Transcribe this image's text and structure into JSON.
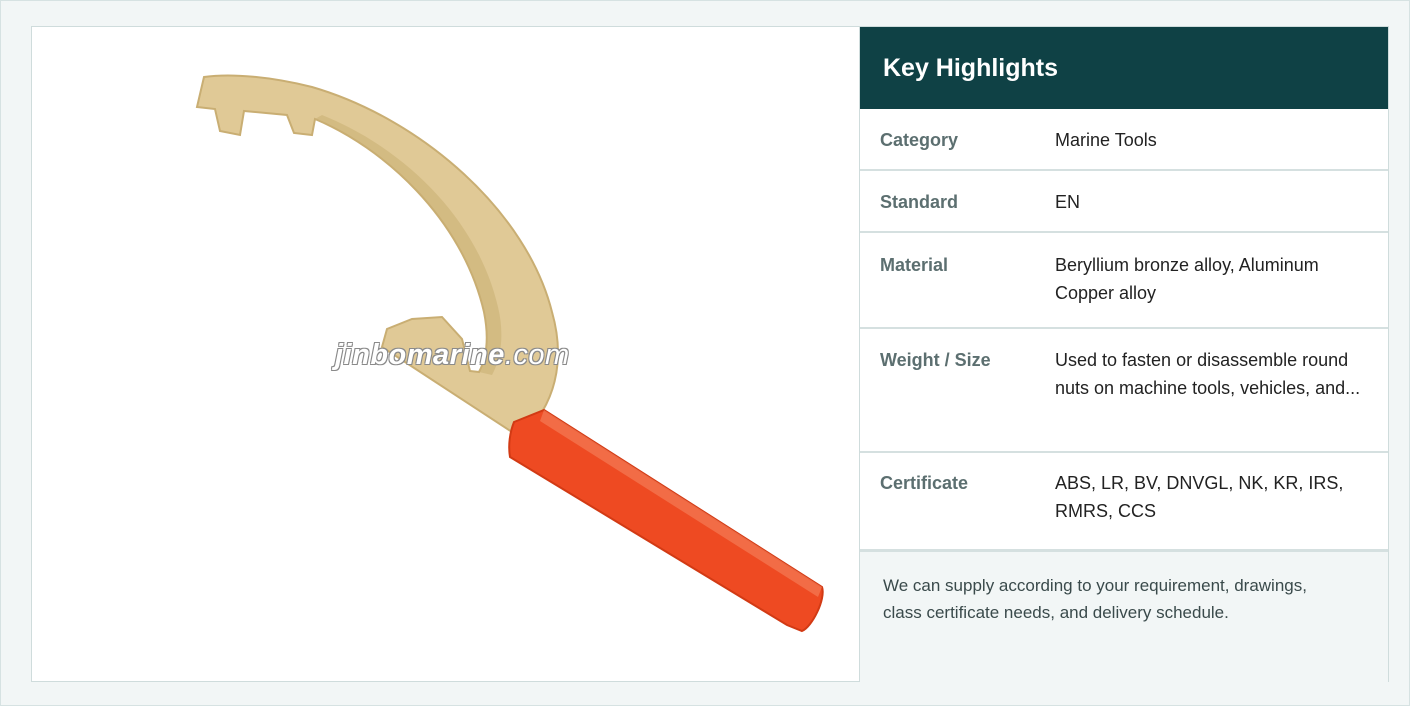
{
  "image": {
    "alt_semantic": "hook-wrench-product-image",
    "watermark": {
      "main": "jinbomarine",
      "suffix": ".com"
    }
  },
  "highlights": {
    "title": "Key Highlights",
    "rows": [
      {
        "key": "Category",
        "value": "Marine Tools"
      },
      {
        "key": "Standard",
        "value": "EN"
      },
      {
        "key": "Material",
        "value": "Beryllium bronze alloy, Aluminum Copper alloy"
      },
      {
        "key": "Weight / Size",
        "value": "Used to fasten or disassemble round nuts on machine tools, vehicles, and..."
      },
      {
        "key": "Certificate",
        "value": "ABS, LR, BV, DNVGL, NK, KR, IRS, RMRS, CCS"
      }
    ],
    "note": "We can supply according to your requirement, drawings, class certificate needs, and delivery schedule."
  },
  "colors": {
    "header_bg": "#0f4145",
    "tool_metal": "#e0c996",
    "tool_handle": "#ee4a22",
    "page_bg": "#f2f6f6"
  }
}
